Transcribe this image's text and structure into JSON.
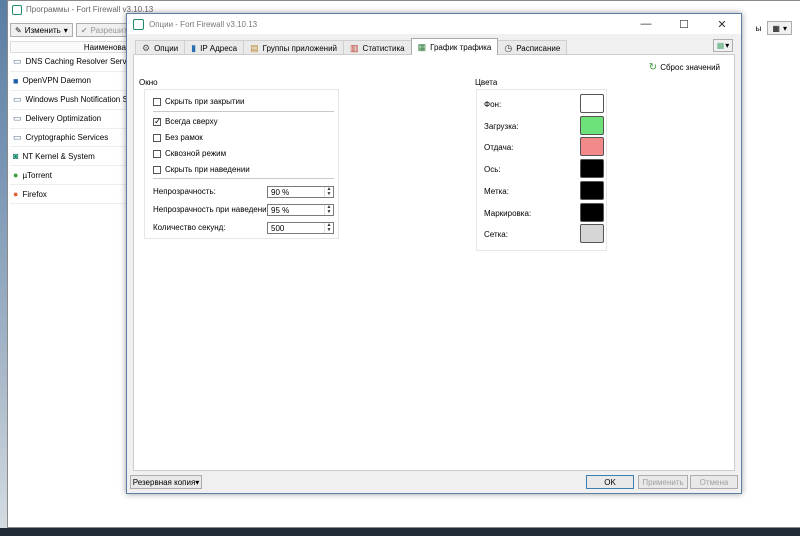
{
  "background_window": {
    "title": "Программы - Fort Firewall v3.10.13",
    "toolbar": {
      "edit_label": "Изменить",
      "allow_label": "Разрешить"
    },
    "right_text": "ы",
    "column_header": "Наименова",
    "programs": [
      {
        "name": "DNS Caching Resolver Service",
        "icon": "service-icon"
      },
      {
        "name": "OpenVPN Daemon",
        "icon": "openvpn-icon"
      },
      {
        "name": "Windows Push Notification Syst",
        "icon": "service-icon"
      },
      {
        "name": "Delivery Optimization",
        "icon": "service-icon"
      },
      {
        "name": "Cryptographic Services",
        "icon": "service-icon"
      },
      {
        "name": "NT Kernel & System",
        "icon": "fort-icon"
      },
      {
        "name": "µTorrent",
        "icon": "utorrent-icon"
      },
      {
        "name": "Firefox",
        "icon": "firefox-icon"
      }
    ]
  },
  "dialog": {
    "title": "Опции - Fort Firewall v3.10.13",
    "tabs": [
      {
        "label": "Опции",
        "icon": "gear-icon",
        "active": false
      },
      {
        "label": "IP Адреса",
        "icon": "ip-icon",
        "active": false
      },
      {
        "label": "Группы приложений",
        "icon": "groups-icon",
        "active": false
      },
      {
        "label": "Статистика",
        "icon": "chart-icon",
        "active": false
      },
      {
        "label": "График трафика",
        "icon": "graph-icon",
        "active": true
      },
      {
        "label": "Расписание",
        "icon": "clock-icon",
        "active": false
      }
    ],
    "reset_label": "Сброс значений",
    "window_section": {
      "title": "Окно",
      "checkboxes": [
        {
          "label": "Скрыть при закрытии",
          "checked": false
        },
        {
          "label": "Всегда сверху",
          "checked": true
        },
        {
          "label": "Без рамок",
          "checked": false
        },
        {
          "label": "Сквозной режим",
          "checked": false
        },
        {
          "label": "Скрыть при наведении",
          "checked": false
        }
      ],
      "opacity_label": "Непрозрачность:",
      "opacity_value": "90 %",
      "hover_opacity_label": "Непрозрачность при наведении:",
      "hover_opacity_value": "95 %",
      "seconds_label": "Количество секунд:",
      "seconds_value": "500"
    },
    "colors_section": {
      "title": "Цвета",
      "items": [
        {
          "label": "Фон:",
          "color": "#ffffff"
        },
        {
          "label": "Загрузка:",
          "color": "#6ee27a"
        },
        {
          "label": "Отдача:",
          "color": "#f28a8a"
        },
        {
          "label": "Ось:",
          "color": "#000000"
        },
        {
          "label": "Метка:",
          "color": "#000000"
        },
        {
          "label": "Маркировка:",
          "color": "#000000"
        },
        {
          "label": "Сетка:",
          "color": "#d6d6d6"
        }
      ]
    },
    "buttons": {
      "backup_label": "Резервная копия",
      "ok_label": "OK",
      "apply_label": "Применить",
      "cancel_label": "Отмена"
    }
  }
}
